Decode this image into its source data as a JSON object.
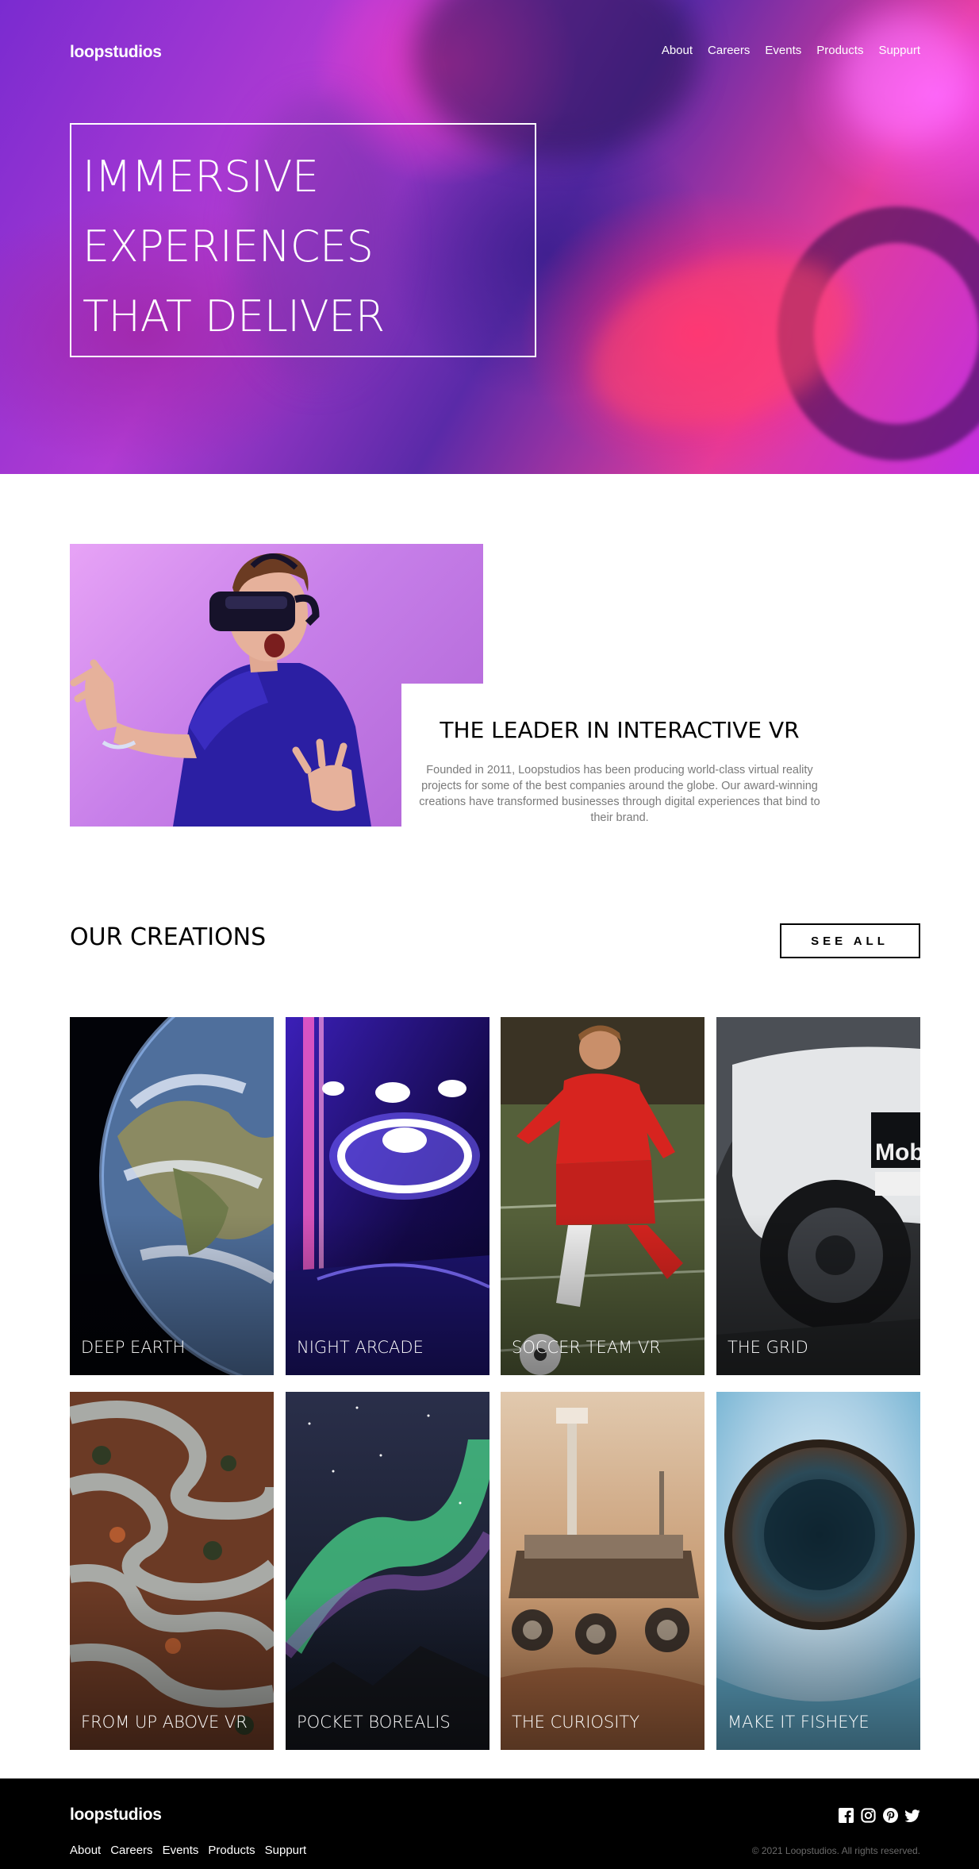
{
  "brand": {
    "logo_text": "loopstudios"
  },
  "nav": {
    "items": [
      {
        "label": "About"
      },
      {
        "label": "Careers"
      },
      {
        "label": "Events"
      },
      {
        "label": "Products"
      },
      {
        "label": "Suppurt"
      }
    ]
  },
  "hero": {
    "title": "IMMERSIVE EXPERIENCES THAT DELIVER",
    "image": "vr-driving-woman-photo"
  },
  "about": {
    "image": "man-with-vr-headset-photo",
    "title": "THE LEADER IN INTERACTIVE VR",
    "text": "Founded in 2011, Loopstudios has been producing world-class virtual reality projects for some of the best companies around the globe. Our award-winning creations have transformed businesses through digital experiences that bind to their brand."
  },
  "creations": {
    "title": "OUR CREATIONS",
    "see_all_label": "SEE ALL",
    "items": [
      {
        "label": "DEEP EARTH"
      },
      {
        "label": "NIGHT ARCADE"
      },
      {
        "label": "SOCCER TEAM VR"
      },
      {
        "label": "THE GRID"
      },
      {
        "label": "FROM UP ABOVE VR"
      },
      {
        "label": "POCKET BOREALIS"
      },
      {
        "label": "THE CURIOSITY"
      },
      {
        "label": "MAKE IT FISHEYE"
      }
    ]
  },
  "footer": {
    "logo_text": "loopstudios",
    "nav": [
      {
        "label": "About"
      },
      {
        "label": "Careers"
      },
      {
        "label": "Events"
      },
      {
        "label": "Products"
      },
      {
        "label": "Suppurt"
      }
    ],
    "social_icons": [
      "facebook-icon",
      "instagram-icon",
      "pinterest-icon",
      "twitter-icon"
    ],
    "copyright": "© 2021 Loopstudios. All rights reserved."
  },
  "colors": {
    "hero_magenta": "#e23c9c",
    "hero_purple": "#7a2bd0",
    "text_grey": "#7a7a7a",
    "footer_bg": "#000000"
  }
}
